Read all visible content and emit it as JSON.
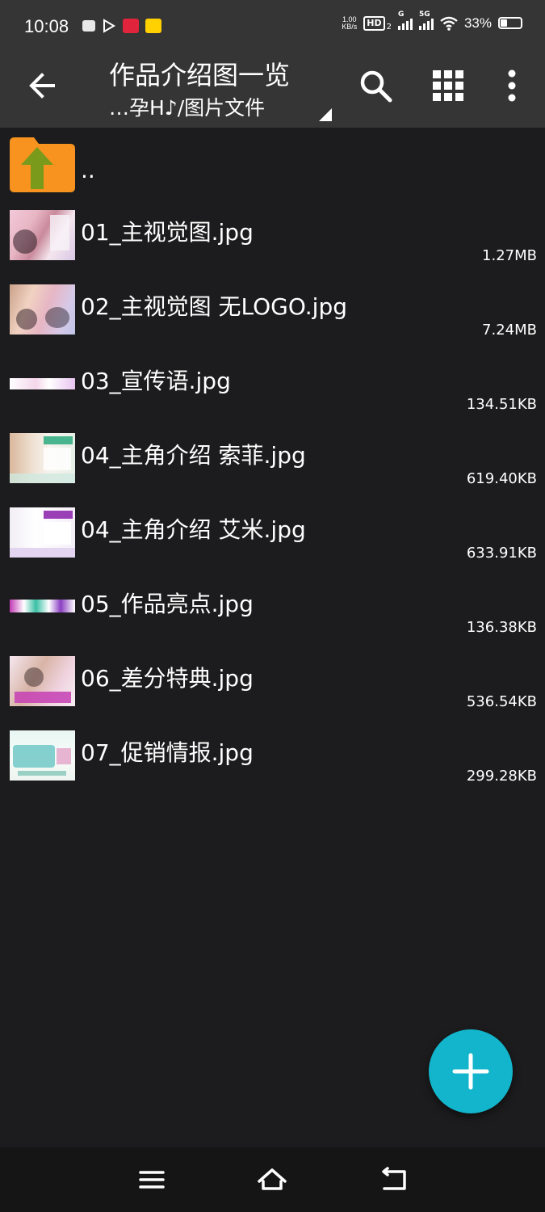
{
  "status": {
    "time": "10:08",
    "net_speed_value": "1.00",
    "net_speed_unit": "KB/s",
    "hd_label": "HD",
    "hd_sub": "2",
    "sim1_label": "G",
    "sim2_label": "5G",
    "battery_percent": "33%"
  },
  "toolbar": {
    "title": "作品介绍图一览",
    "subtitle": "…孕H♪/图片文件"
  },
  "files": [
    {
      "name": "..",
      "size": "",
      "thumb_icon": "folder-up-icon"
    },
    {
      "name": "01_主视觉图.jpg",
      "size": "1.27MB"
    },
    {
      "name": "02_主视觉图 无LOGO.jpg",
      "size": "7.24MB"
    },
    {
      "name": "03_宣传语.jpg",
      "size": "134.51KB"
    },
    {
      "name": "04_主角介绍 索菲.jpg",
      "size": "619.40KB"
    },
    {
      "name": "04_主角介绍 艾米.jpg",
      "size": "633.91KB"
    },
    {
      "name": "05_作品亮点.jpg",
      "size": "136.38KB"
    },
    {
      "name": "06_差分特典.jpg",
      "size": "536.54KB"
    },
    {
      "name": "07_促销情报.jpg",
      "size": "299.28KB"
    }
  ],
  "colors": {
    "accent_fab": "#12b5cb",
    "toolbar_bg": "#353535",
    "list_bg": "#1c1c1e",
    "folder_orange": "#f7931e",
    "folder_arrow_green": "#7a9a1c"
  }
}
